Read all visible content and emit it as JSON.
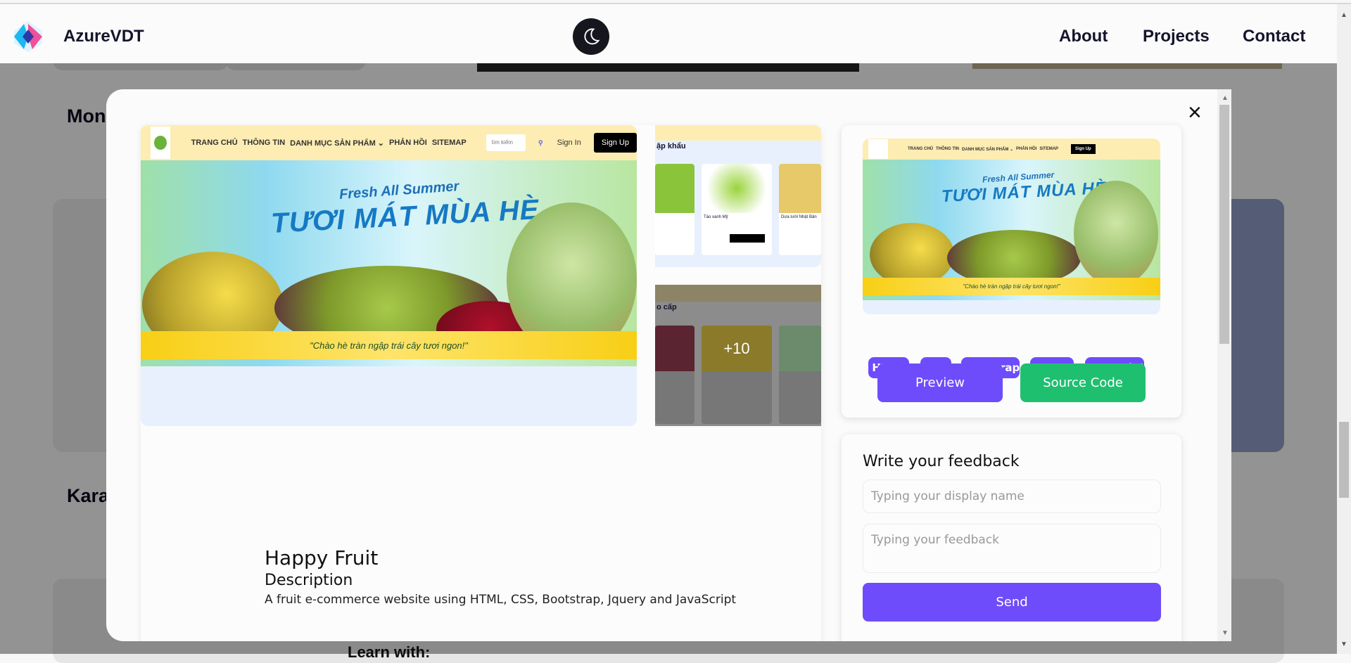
{
  "header": {
    "brand": "AzureVDT",
    "nav": [
      "About",
      "Projects",
      "Contact"
    ]
  },
  "background": {
    "headings": [
      "Mon",
      "Kara"
    ],
    "partial_text": "Learn with:"
  },
  "modal": {
    "close_label": "×",
    "project": {
      "title": "Happy Fruit",
      "description_heading": "Description",
      "description": "A fruit e-commerce website using HTML, CSS, Bootstrap, Jquery and JavaScript"
    },
    "screenshot": {
      "nav": [
        "TRANG CHỦ",
        "THÔNG TIN",
        "DANH MỤC SẢN PHẨM ⌄",
        "PHẢN HỒI",
        "SITEMAP"
      ],
      "search_placeholder": "tìm kiếm",
      "sign_in": "Sign In",
      "sign_up": "Sign Up",
      "banner_small": "Fresh All Summer",
      "banner_title": "TƯƠI MÁT MÙA HÈ",
      "banner_slogan": "\"Chào hè tràn ngập trái cây tươi ngon!\"",
      "side1_heading": "ập khẩu",
      "side1_products": [
        "Táo xanh Mỹ",
        "Dưa lưới Nhật Bản"
      ],
      "side2_heading": "o cấp",
      "side2_overlay": "+10"
    },
    "tags": [
      "HTML",
      "CSS",
      "Bootstrap",
      "Jquery",
      "JavaScript"
    ],
    "buttons": {
      "preview": "Preview",
      "source": "Source Code"
    },
    "feedback": {
      "heading": "Write your feedback",
      "name_placeholder": "Typing your display name",
      "feedback_placeholder": "Typing your feedback",
      "send": "Send"
    }
  },
  "colors": {
    "accent": "#6e4cfc",
    "success": "#1fbf70",
    "banner_yellow": "#fdedb3"
  }
}
